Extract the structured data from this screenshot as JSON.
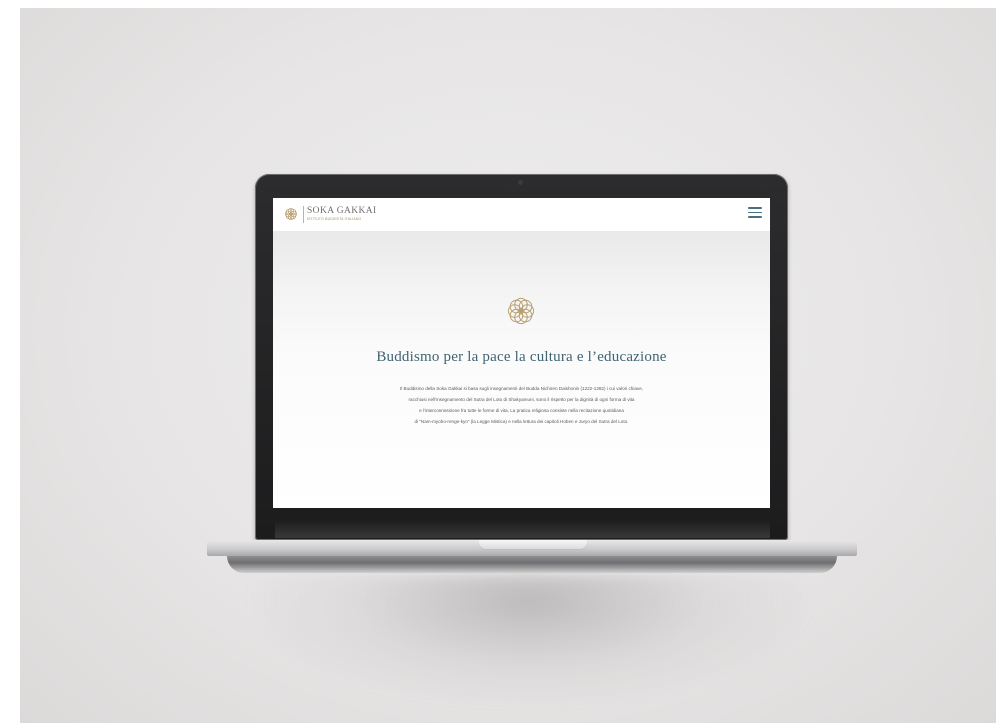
{
  "site": {
    "logo_title": "SOKA GAKKAI",
    "logo_subtitle": "ISTITUTO BUDDISTA ITALIANO",
    "menu_icon": "hamburger-menu-icon",
    "emblem_icon": "lotus-emblem-icon"
  },
  "hero": {
    "heading": "Buddismo per la pace la cultura e l’educazione",
    "body_lines": [
      "Il Buddismo della Soka Gakkai si basa sugli insegnamenti del Budda Nichiren Daishonin (1222-1282) i cui valori chiave,",
      "racchiusi nell’insegnamento del Sutra del Loto di Shakyamuni, sono il rispetto per la dignità di ogni forma di vita",
      "e l’interconnessione fra tutte le forme di vita. La pratica religiosa consiste nella recitazione quotidiana",
      "di “Nam-myoho-renge-kyo” (la Legge Mistica) e nella lettura dei capitoli Hoben e Juryo del Sutra del Loto."
    ]
  },
  "colors": {
    "accent_teal": "#3f6373",
    "gold": "#c9b48a",
    "backdrop": "#e7e5e5"
  }
}
